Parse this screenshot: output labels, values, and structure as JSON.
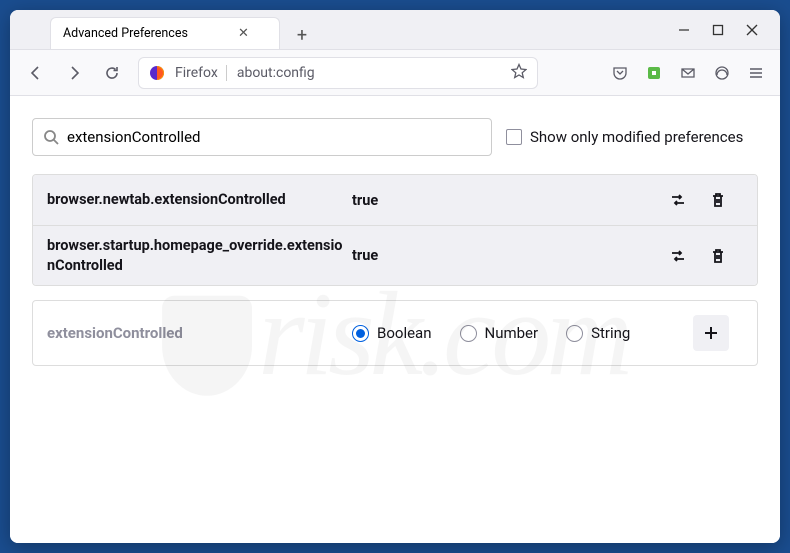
{
  "tab": {
    "title": "Advanced Preferences"
  },
  "addressbar": {
    "label": "Firefox",
    "url": "about:config"
  },
  "search": {
    "value": "extensionControlled",
    "show_modified_label": "Show only modified preferences"
  },
  "prefs": [
    {
      "name": "browser.newtab.extensionControlled",
      "value": "true"
    },
    {
      "name": "browser.startup.homepage_override.extensionControlled",
      "value": "true"
    }
  ],
  "create": {
    "name": "extensionControlled",
    "options": {
      "boolean": "Boolean",
      "number": "Number",
      "string": "String"
    },
    "selected": "boolean"
  }
}
